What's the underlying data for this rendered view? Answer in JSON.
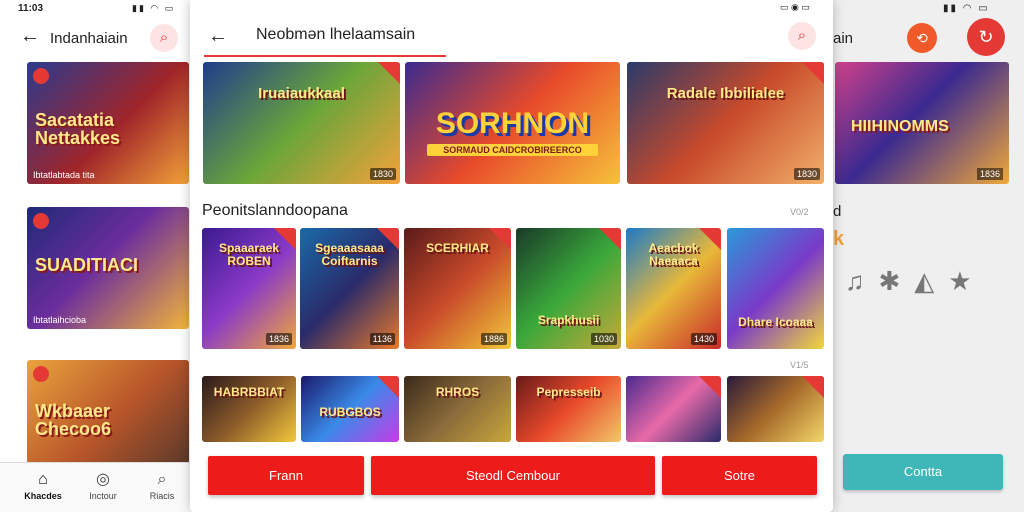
{
  "left_screen": {
    "time": "11:03",
    "title": "Indanhaiain",
    "cards": [
      {
        "label": "Sacatatia Nettakkes",
        "caption": "Ibtatlabtada tita"
      },
      {
        "label": "SUADITIACI",
        "caption": "Ibtatlaihcioba"
      },
      {
        "label": "Wkbaaer Checoo6",
        "caption": ""
      }
    ],
    "nav": [
      {
        "label": "Khacdes",
        "icon": "home-icon"
      },
      {
        "label": "Inctour",
        "icon": "compass-icon"
      },
      {
        "label": "Riacis",
        "icon": "search-icon"
      }
    ]
  },
  "modal": {
    "title": "Neobmən lhelaamsain",
    "hero_tiles": [
      {
        "label": "Iruaiaukkaal",
        "tag": "1830",
        "colors": [
          "#1f3c8c",
          "#6aa53a",
          "#f4a23a"
        ]
      },
      {
        "label": "SORHNON",
        "subtitle": "SORMAUD CAIDCROBIREERCO",
        "tag": "",
        "colors": [
          "#3a2a8f",
          "#e84a2a",
          "#f6c23a"
        ]
      },
      {
        "label": "Radale Ibbilialee",
        "tag": "1830",
        "colors": [
          "#2a3a6a",
          "#c84a2a",
          "#f2b06a"
        ]
      }
    ],
    "section_title": "Peonitslanndoopana",
    "section_more": "V0/2",
    "square_tiles": [
      {
        "label": "Spaaaraek ROBEN",
        "tag": "1836",
        "colors": [
          "#3a1a8f",
          "#8a3ac8",
          "#f0a83a"
        ]
      },
      {
        "label": "Sgeaaasaaa Coiftarnis",
        "tag": "1136",
        "colors": [
          "#1a6aa8",
          "#2a2a6a",
          "#e87a2a"
        ]
      },
      {
        "label": "SCERHIAR",
        "tag": "1886",
        "colors": [
          "#5a1a1a",
          "#c84a2a",
          "#f2c83a"
        ]
      },
      {
        "label": "Srapkhusii",
        "tag": "1030",
        "colors": [
          "#1a3a2a",
          "#3aa83a",
          "#c8a83a"
        ]
      },
      {
        "label": "Aeacbok Naeaaca",
        "tag": "1430",
        "colors": [
          "#1a7ac8",
          "#e8b83a",
          "#c82a2a"
        ]
      },
      {
        "label": "Dhare Icoaaa",
        "tag": "",
        "colors": [
          "#2a9ad8",
          "#7a3ac8",
          "#f2d83a"
        ]
      }
    ],
    "second_more": "V1/5",
    "small_tiles": [
      {
        "label": "HABRBBIAT",
        "colors": [
          "#2a1a1a",
          "#8a5a2a",
          "#f2c83a"
        ]
      },
      {
        "label": "RUBGBOS",
        "colors": [
          "#1a1a6a",
          "#3a8ae8",
          "#c83ae8"
        ]
      },
      {
        "label": "RHROS",
        "colors": [
          "#3a2a1a",
          "#8a6a3a",
          "#c8a83a"
        ]
      },
      {
        "label": "Pepresseib",
        "colors": [
          "#6a1a1a",
          "#e84a2a",
          "#f2c86a"
        ]
      },
      {
        "label": "",
        "colors": [
          "#4a2a8f",
          "#e86aa8",
          "#2a2a6a"
        ]
      },
      {
        "label": "",
        "colors": [
          "#2a1a3a",
          "#a86a2a",
          "#f2d86a"
        ]
      }
    ],
    "buttons": [
      {
        "label": "Frann"
      },
      {
        "label": "Steodl Cembour"
      },
      {
        "label": "Sotre"
      }
    ]
  },
  "right_screen": {
    "title_fragment": "ain",
    "card": {
      "label": "HIIHINOMMS",
      "caption": "1836"
    },
    "fragment": "d",
    "fragment2": "k",
    "confirm_label": "Contta"
  },
  "colors": {
    "accent_red": "#e53935",
    "button_red": "#ee1b1b",
    "teal": "#3fb6b8"
  }
}
